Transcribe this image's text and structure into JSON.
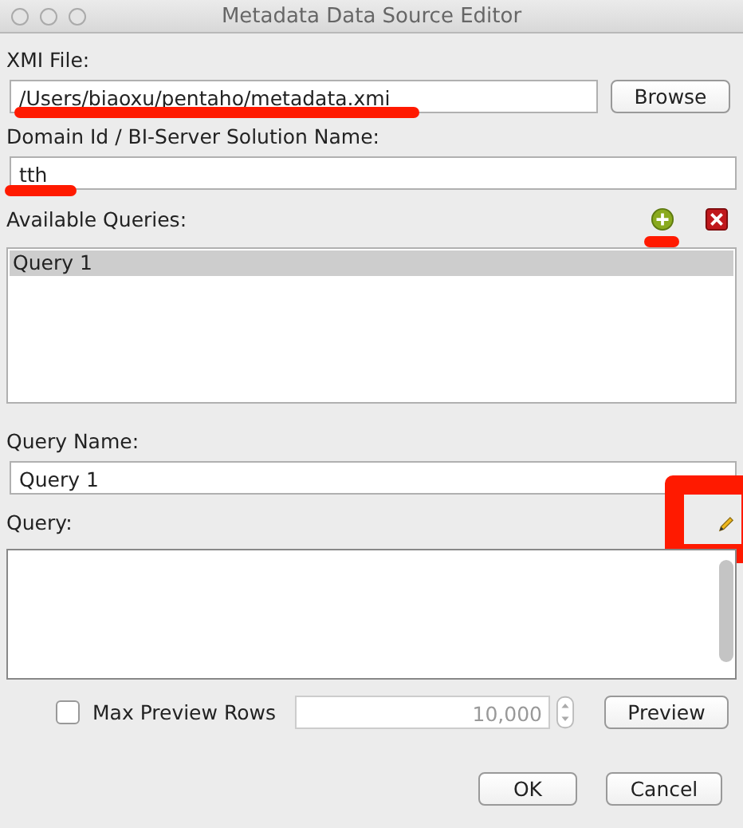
{
  "window": {
    "title": "Metadata Data Source Editor"
  },
  "xmi_file": {
    "label": "XMI File:",
    "value": "/Users/biaoxu/pentaho/metadata.xmi",
    "button": "Browse"
  },
  "domain": {
    "label": "Domain Id / BI-Server Solution Name:",
    "value": "tth"
  },
  "available_queries": {
    "label": "Available Queries:",
    "items": [
      {
        "name": "Query 1",
        "selected": true
      }
    ]
  },
  "query_name": {
    "label": "Query Name:",
    "value": "Query 1"
  },
  "query": {
    "label": "Query:"
  },
  "max_preview_rows": {
    "label": "Max Preview Rows",
    "checked": false,
    "value": "10,000",
    "disabled": true
  },
  "buttons": [
    {
      "label": "Preview",
      "kind": "preview"
    },
    {
      "label": "OK",
      "kind": "ok"
    },
    {
      "label": "Cancel",
      "kind": "cancel"
    }
  ]
}
